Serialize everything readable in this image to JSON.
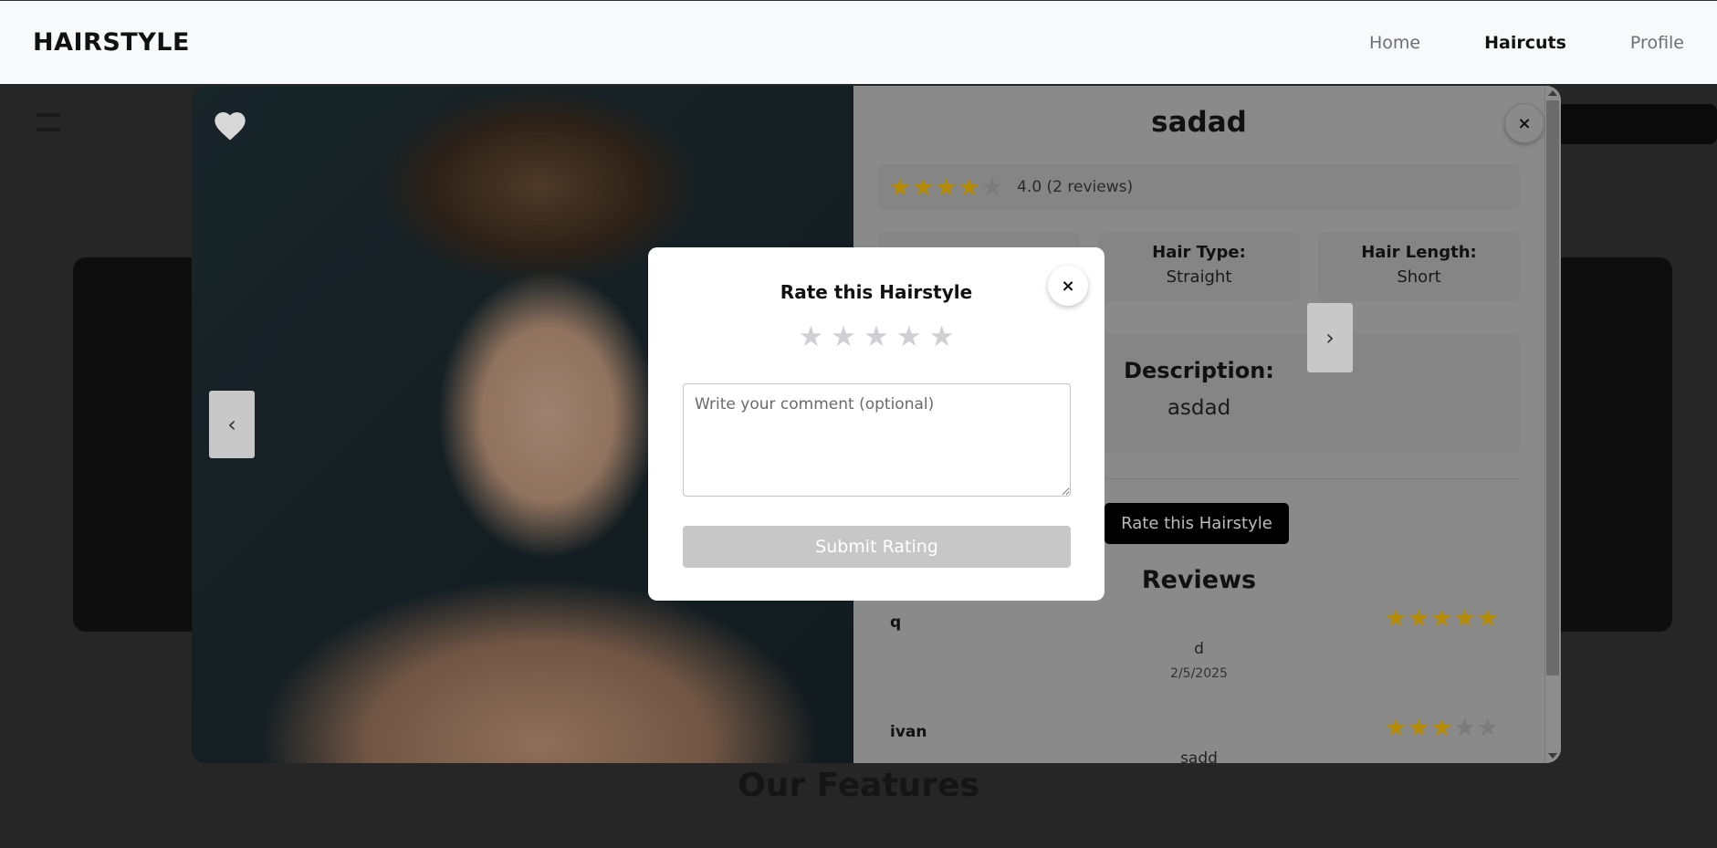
{
  "navbar": {
    "brand": "HAIRSTYLE",
    "links": [
      {
        "label": "Home",
        "active": false
      },
      {
        "label": "Haircuts",
        "active": true
      },
      {
        "label": "Profile",
        "active": false
      }
    ]
  },
  "background": {
    "features_heading": "Our Features"
  },
  "hairstyle_modal": {
    "title": "sadad",
    "rating": {
      "value": 4,
      "max": 5,
      "text": "4.0 (2 reviews)"
    },
    "info": [
      {
        "label": "",
        "value": ""
      },
      {
        "label": "Hair Type:",
        "value": "Straight"
      },
      {
        "label": "Hair Length:",
        "value": "Short"
      }
    ],
    "description": {
      "label": "Description:",
      "value": "asdad"
    },
    "rate_button": "Rate this Hairstyle",
    "reviews_title": "Reviews",
    "reviews": [
      {
        "user": "q",
        "stars": 5,
        "comment": "d",
        "date": "2/5/2025"
      },
      {
        "user": "ivan",
        "stars": 3,
        "comment": "sadd",
        "date": ""
      }
    ],
    "prev_arrow": "‹",
    "next_arrow": "›",
    "close": "×"
  },
  "rating_dialog": {
    "title": "Rate this Hairstyle",
    "star_count": 5,
    "selected": 0,
    "comment_placeholder": "Write your comment (optional)",
    "submit_label": "Submit Rating",
    "close": "×"
  },
  "colors": {
    "star_gold": "#b58a05",
    "submit_disabled": "#c7c7c7",
    "brand_text": "#111111"
  }
}
